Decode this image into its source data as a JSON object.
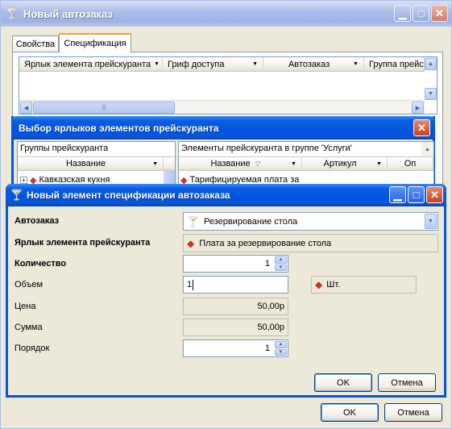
{
  "main_window": {
    "title": "Новый автозаказ",
    "tabs": [
      {
        "label": "Свойства",
        "active": false
      },
      {
        "label": "Спецификация",
        "active": true
      }
    ],
    "spec_columns": [
      "Ярлык элемента прейскуранта",
      "Гриф доступа",
      "Автозаказ",
      "Группа прейс"
    ],
    "ok_label": "OK",
    "cancel_label": "Отмена"
  },
  "selector_window": {
    "title": "Выбор ярлыков элементов прейскуранта",
    "groups_title": "Группы прейскуранта",
    "groups_column": "Название",
    "groups": [
      "Кавказская кухня"
    ],
    "items_title": "Элементы прейскуранта в группе 'Услуги'",
    "items_columns": [
      "Название",
      "Артикул",
      "Оп"
    ],
    "items": [
      "Тарифицируемая плата за"
    ]
  },
  "dialog": {
    "title": "Новый элемент спецификации автозаказа",
    "fields": {
      "order": {
        "label": "Автозаказ",
        "value": "Резервирование стола"
      },
      "tag": {
        "label": "Ярлык элемента прейскуранта",
        "value": "Плата за резервирование стола"
      },
      "quantity": {
        "label": "Количество",
        "value": "1"
      },
      "volume": {
        "label": "Объем",
        "value": "1",
        "unit": "Шт."
      },
      "price": {
        "label": "Цена",
        "value": "50,00р"
      },
      "sum": {
        "label": "Сумма",
        "value": "50,00р"
      },
      "order_num": {
        "label": "Порядок",
        "value": "1"
      }
    },
    "ok_label": "OK",
    "cancel_label": "Отмена"
  },
  "colors": {
    "title_active": "#0054e3",
    "title_inactive": "#a9bbe8",
    "window_bg": "#ece9d8",
    "close_red": "#c5411f"
  }
}
